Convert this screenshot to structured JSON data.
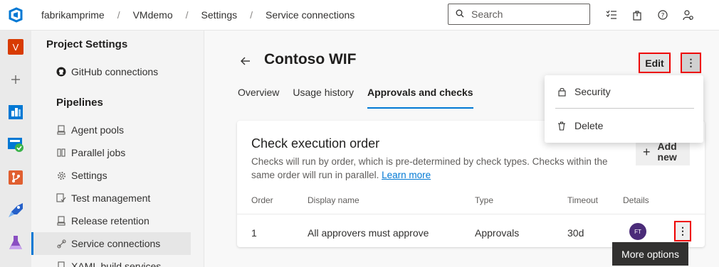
{
  "topbar": {
    "breadcrumbs": [
      "fabrikamprime",
      "VMdemo",
      "Settings",
      "Service connections"
    ],
    "search_placeholder": "Search",
    "icons": [
      "task-list-icon",
      "shopping-bag-icon",
      "help-icon",
      "user-settings-icon"
    ]
  },
  "rail": {
    "project_initial": "V",
    "items": [
      "add-icon",
      "boards-icon",
      "repos-icon",
      "pipelines-icon",
      "artifacts-icon",
      "test-plans-icon"
    ]
  },
  "sidebar": {
    "heading": "Project Settings",
    "github_item": "GitHub connections",
    "pipelines_section": "Pipelines",
    "items": [
      "Agent pools",
      "Parallel jobs",
      "Settings",
      "Test management",
      "Release retention",
      "Service connections",
      "XAML build services"
    ],
    "selected": "Service connections"
  },
  "page": {
    "title": "Contoso WIF",
    "edit_label": "Edit",
    "more_label": "⋮",
    "tabs": [
      "Overview",
      "Usage history",
      "Approvals and checks"
    ],
    "active_tab": "Approvals and checks"
  },
  "card": {
    "title": "Check execution order",
    "description": "Checks will run by order, which is pre-determined by check types. Checks within the same order will run in parallel.",
    "learn_more": "Learn more",
    "add_new": "Add new",
    "columns": [
      "Order",
      "Display name",
      "Type",
      "Timeout",
      "Details"
    ],
    "row": {
      "order": "1",
      "display_name": "All approvers must approve",
      "type": "Approvals",
      "timeout": "30d",
      "avatar": "FT"
    }
  },
  "menu": {
    "security": "Security",
    "delete": "Delete"
  },
  "tooltip": "More options",
  "colors": {
    "accent": "#0078d4",
    "highlight_border": "#ee0000",
    "avatar_bg": "#4b2c79",
    "project_avatar": "#d83b01"
  }
}
